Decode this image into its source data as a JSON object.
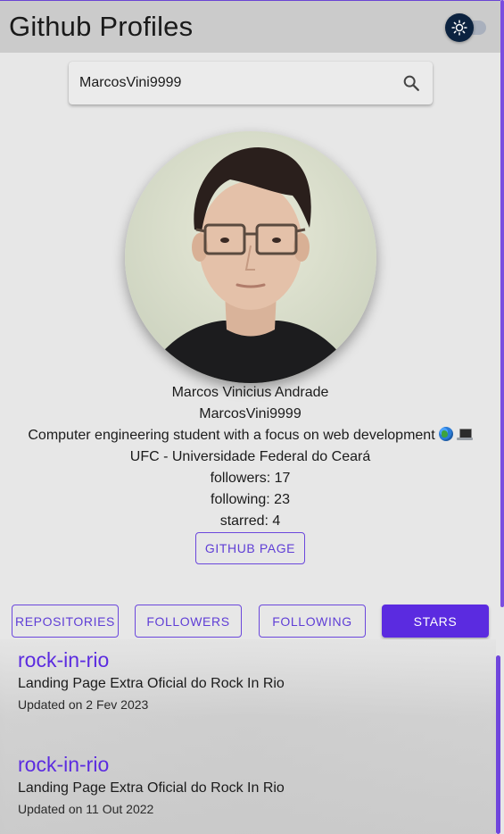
{
  "header": {
    "title": "Github Profiles",
    "theme_toggle_icon": "sun-icon",
    "toggle_on": false
  },
  "search": {
    "value": "MarcosVini9999",
    "placeholder": "",
    "icon": "search-icon"
  },
  "profile": {
    "name": "Marcos Vinicius Andrade",
    "login": "MarcosVini9999",
    "bio": "Computer engineering student with a focus on web development",
    "bio_emojis": [
      "globe-emoji",
      "laptop-emoji"
    ],
    "company": "UFC - Universidade Federal do Ceará",
    "followers": "followers: 17",
    "following": "following: 23",
    "starred": "starred: 4",
    "github_page_label": "GITHUB PAGE"
  },
  "tabs": [
    {
      "label": "REPOSITORIES",
      "active": false
    },
    {
      "label": "FOLLOWERS",
      "active": false
    },
    {
      "label": "FOLLOWING",
      "active": false
    },
    {
      "label": "STARS",
      "active": true
    }
  ],
  "repos": [
    {
      "name": "rock-in-rio",
      "description": "Landing Page Extra Oficial do Rock In Rio",
      "updated": "Updated on 2 Fev 2023"
    },
    {
      "name": "rock-in-rio",
      "description": "Landing Page Extra Oficial do Rock In Rio",
      "updated": "Updated on 11 Out 2022"
    }
  ],
  "colors": {
    "accent": "#5b2be0",
    "header_bg": "#cbcbcb",
    "page_bg": "#e7e7e7",
    "toggle_thumb": "#0c2340"
  }
}
